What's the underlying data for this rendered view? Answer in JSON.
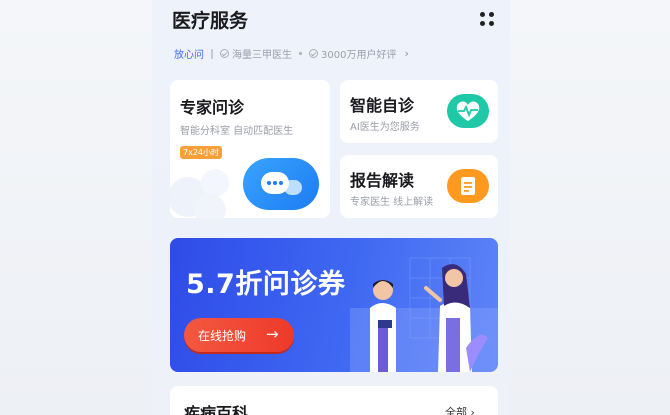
{
  "header": {
    "title": "医疗服务"
  },
  "tags": {
    "t1": "放心问",
    "t2": "海量三甲医生",
    "t3": "3000万用户好评"
  },
  "cards": {
    "expert": {
      "title": "专家问诊",
      "subtitle": "智能分科室 自动匹配医生",
      "badge": "7x24小时"
    },
    "smart": {
      "title": "智能自诊",
      "subtitle": "AI医生为您服务"
    },
    "report": {
      "title": "报告解读",
      "subtitle": "专家医生 线上解读"
    }
  },
  "banner": {
    "title": "5.7折问诊券",
    "button": "在线抢购"
  },
  "encyclopedia": {
    "title": "疾病百科",
    "more": "全部"
  },
  "colors": {
    "accent": "#3d6ef3",
    "green": "#1fc8a6",
    "orange": "#ff9a1f",
    "banner": "#3f69f2",
    "buy": "#ee3a2a"
  },
  "icons": [
    "grid-menu-icon",
    "check-icon",
    "chevron-right-icon",
    "chat-bubble-icon",
    "heart-pulse-icon",
    "report-doc-icon",
    "arrow-right-icon"
  ]
}
